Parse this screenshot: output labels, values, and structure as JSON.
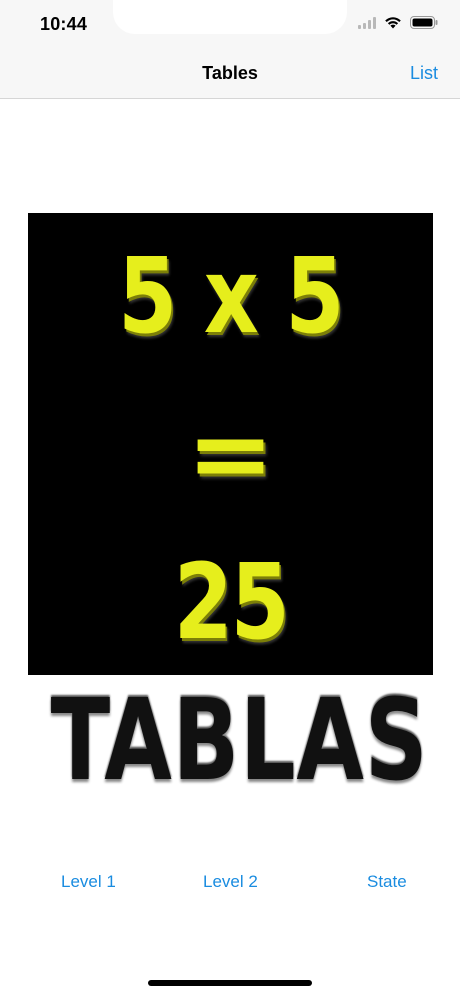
{
  "status_bar": {
    "time": "10:44",
    "icons": [
      "signal-icon",
      "wifi-icon",
      "battery-icon"
    ]
  },
  "nav": {
    "title": "Tables",
    "right_action": "List"
  },
  "image": {
    "line_1": "5 x 5",
    "line_2": "=",
    "line_3": "25",
    "brand": "TABLAS",
    "colors": {
      "background": "#000000",
      "digits": "#e6ee1c",
      "brand_text": "#111111"
    }
  },
  "bottom": {
    "buttons": [
      "Level 1",
      "Level 2",
      "State"
    ]
  },
  "colors": {
    "accent": "#1a8ce0",
    "bar_background": "#f7f7f7"
  }
}
